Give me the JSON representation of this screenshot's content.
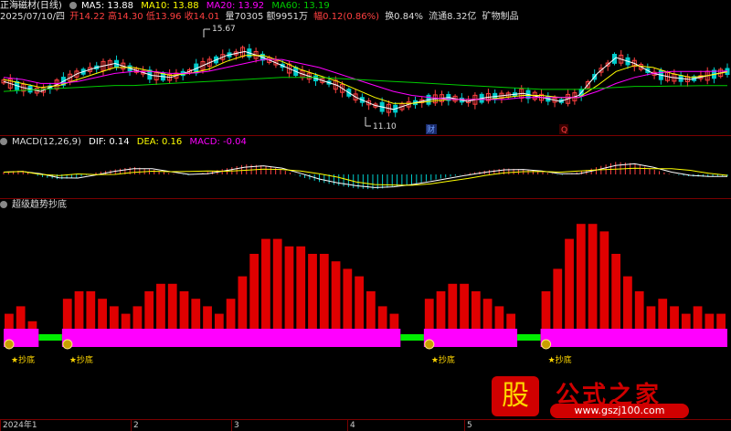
{
  "window": {
    "stock_name": "正海磁材",
    "period": "(日线)"
  },
  "price_header": {
    "ma5": "MA5: 13.88",
    "ma10": "MA10: 13.88",
    "ma20": "MA20: 13.92",
    "ma60": "MA60: 13.19"
  },
  "quote_line": {
    "date": "2025/07/10/四",
    "open": "开14.22",
    "high": "高14.30",
    "low": "低13.96",
    "close": "收14.01",
    "volume": "量70305",
    "amount": "额9951万",
    "change": "幅0.12(0.86%)",
    "turnover": "换0.84%",
    "float": "流通8.32亿",
    "industry": "矿物制品"
  },
  "price_labels": {
    "high_mark": "15.67",
    "low_mark": "11.10",
    "marker_cai": "财",
    "marker_q": "Q"
  },
  "macd_header": {
    "title": "MACD(12,26,9)",
    "dif": "DIF: 0.14",
    "dea": "DEA: 0.16",
    "macd": "MACD: -0.04"
  },
  "indicator_header": {
    "title": "超级趋势抄底"
  },
  "signals": {
    "label": "★抄底"
  },
  "time_axis": [
    "2024年1",
    "2",
    "3",
    "4",
    "5"
  ],
  "watermark": {
    "glyph": "股",
    "text": "公式之家",
    "url": "www.gszj100.com"
  },
  "colors": {
    "background": "#000000",
    "up": "#ff4040",
    "down": "#00cccc",
    "ma5": "#ffffff",
    "ma10": "#ffff00",
    "ma20": "#ff00ff",
    "ma60": "#00cc00",
    "bar": "#e00000",
    "band_magenta": "#ff00ff",
    "band_green": "#00ee00"
  },
  "chart_data": [
    {
      "type": "line",
      "title": "正海磁材 (日线)",
      "series": [
        {
          "name": "MA5",
          "values": [
            13.4,
            13.1,
            12.9,
            13.3,
            13.8,
            14.1,
            14.3,
            14.0,
            13.7,
            13.6,
            13.9,
            14.3,
            14.7,
            14.9,
            14.6,
            14.2,
            13.8,
            13.5,
            13.2,
            12.6,
            12.2,
            12.0,
            12.3,
            12.5,
            12.6,
            12.4,
            12.6,
            12.7,
            12.8,
            12.6,
            12.4,
            12.7,
            13.8,
            14.6,
            14.3,
            13.8,
            13.6,
            13.5,
            13.7,
            13.9
          ]
        },
        {
          "name": "MA10",
          "values": [
            13.5,
            13.3,
            13.1,
            13.2,
            13.5,
            13.8,
            14.1,
            14.1,
            13.9,
            13.7,
            13.8,
            14.0,
            14.4,
            14.7,
            14.7,
            14.4,
            14.0,
            13.7,
            13.4,
            13.0,
            12.6,
            12.3,
            12.3,
            12.4,
            12.5,
            12.5,
            12.5,
            12.6,
            12.7,
            12.7,
            12.6,
            12.6,
            13.2,
            13.9,
            14.2,
            14.1,
            13.8,
            13.6,
            13.7,
            13.88
          ]
        },
        {
          "name": "MA20",
          "values": [
            13.6,
            13.5,
            13.3,
            13.3,
            13.4,
            13.6,
            13.8,
            13.9,
            13.9,
            13.8,
            13.8,
            13.9,
            14.1,
            14.3,
            14.5,
            14.5,
            14.3,
            14.1,
            13.8,
            13.5,
            13.2,
            12.9,
            12.7,
            12.6,
            12.5,
            12.5,
            12.5,
            12.5,
            12.6,
            12.6,
            12.6,
            12.6,
            12.9,
            13.3,
            13.6,
            13.8,
            13.9,
            13.9,
            13.9,
            13.92
          ]
        },
        {
          "name": "MA60",
          "values": [
            12.9,
            12.95,
            13.0,
            13.05,
            13.1,
            13.15,
            13.2,
            13.2,
            13.25,
            13.3,
            13.35,
            13.4,
            13.45,
            13.5,
            13.55,
            13.6,
            13.6,
            13.6,
            13.55,
            13.5,
            13.45,
            13.4,
            13.35,
            13.3,
            13.25,
            13.2,
            13.15,
            13.1,
            13.05,
            13.0,
            13.0,
            13.0,
            13.05,
            13.1,
            13.15,
            13.15,
            13.17,
            13.18,
            13.19,
            13.19
          ]
        }
      ]
    },
    {
      "type": "bar",
      "title": "MACD(12,26,9)",
      "series": [
        {
          "name": "MACD",
          "values": [
            0.05,
            0.08,
            -0.05,
            -0.1,
            -0.06,
            0.04,
            0.1,
            0.15,
            0.1,
            0.02,
            -0.02,
            0.05,
            0.12,
            0.2,
            0.18,
            0.1,
            -0.05,
            -0.15,
            -0.22,
            -0.28,
            -0.3,
            -0.25,
            -0.2,
            -0.12,
            -0.05,
            0.02,
            0.08,
            0.12,
            0.1,
            0.05,
            -0.02,
            0.05,
            0.15,
            0.25,
            0.22,
            0.1,
            0.0,
            -0.04,
            -0.05,
            -0.04
          ]
        }
      ]
    },
    {
      "type": "bar",
      "title": "超级趋势抄底",
      "series": [
        {
          "name": "超级趋势抄底",
          "values": [
            2,
            3,
            1,
            0,
            0,
            4,
            5,
            5,
            4,
            3,
            2,
            3,
            5,
            6,
            6,
            5,
            4,
            3,
            2,
            4,
            7,
            10,
            12,
            12,
            11,
            11,
            10,
            10,
            9,
            8,
            7,
            5,
            3,
            2,
            0,
            0,
            4,
            5,
            6,
            6,
            5,
            4,
            3,
            2,
            0,
            0,
            5,
            8,
            12,
            14,
            14,
            13,
            10,
            7,
            5,
            3,
            4,
            3,
            2,
            3,
            2,
            2
          ]
        }
      ]
    }
  ]
}
